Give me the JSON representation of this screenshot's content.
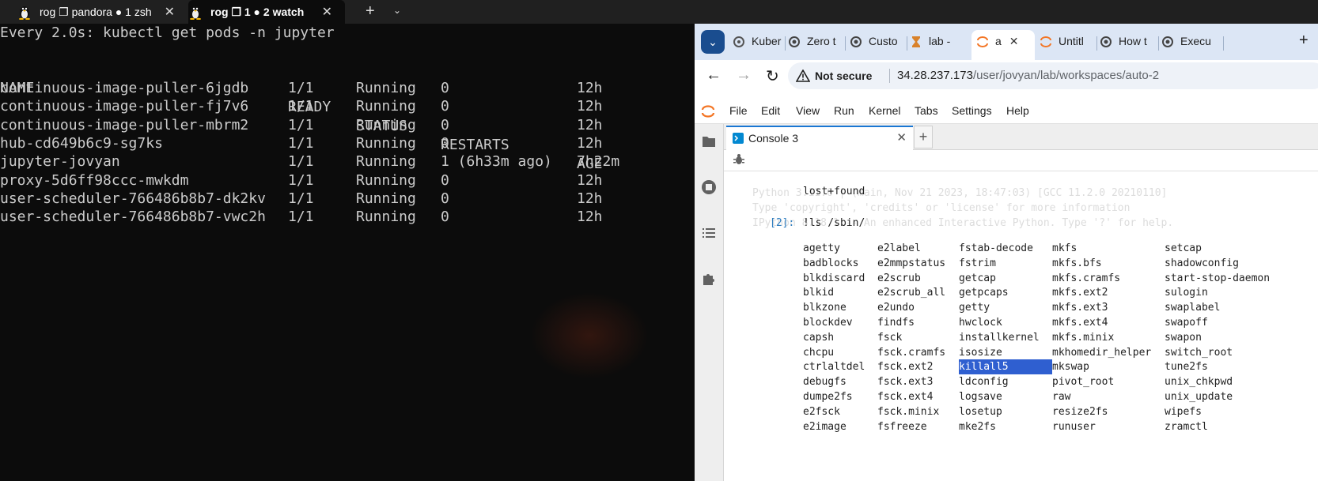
{
  "terminal": {
    "tabs": [
      {
        "label": "rog ❐ pandora ● 1 zsh"
      },
      {
        "label": "rog ❐ 1 ● 2 watch"
      }
    ],
    "header": "Every 2.0s: kubectl get pods -n jupyter",
    "columns": [
      "NAME",
      "READY",
      "STATUS",
      "RESTARTS",
      "AGE"
    ],
    "rows": [
      [
        "continuous-image-puller-6jgdb",
        "1/1",
        "Running",
        "0",
        "12h"
      ],
      [
        "continuous-image-puller-fj7v6",
        "1/1",
        "Running",
        "0",
        "12h"
      ],
      [
        "continuous-image-puller-mbrm2",
        "1/1",
        "Running",
        "0",
        "12h"
      ],
      [
        "hub-cd649b6c9-sg7ks",
        "1/1",
        "Running",
        "0",
        "12h"
      ],
      [
        "jupyter-jovyan",
        "1/1",
        "Running",
        "1 (6h33m ago)",
        "7h22m"
      ],
      [
        "proxy-5d6ff98ccc-mwkdm",
        "1/1",
        "Running",
        "0",
        "12h"
      ],
      [
        "user-scheduler-766486b8b7-dk2kv",
        "1/1",
        "Running",
        "0",
        "12h"
      ],
      [
        "user-scheduler-766486b8b7-vwc2h",
        "1/1",
        "Running",
        "0",
        "12h"
      ]
    ]
  },
  "browser": {
    "tabs": [
      {
        "label": "Kuber"
      },
      {
        "label": "Zero t"
      },
      {
        "label": "Custo"
      },
      {
        "label": "lab - "
      },
      {
        "label": "a"
      },
      {
        "label": "Untitl"
      },
      {
        "label": "How t"
      },
      {
        "label": "Execu"
      }
    ],
    "security": "Not secure",
    "url_host": "34.28.237.173",
    "url_path": "/user/jovyan/lab/workspaces/auto-2"
  },
  "jupyterlab": {
    "menus": [
      "File",
      "Edit",
      "View",
      "Run",
      "Kernel",
      "Tabs",
      "Settings",
      "Help"
    ],
    "console_tab": "Console 3",
    "ghost_lines": [
      "Python 3.11.6 | (main, Nov 21 2023, 18:47:03) [GCC 11.2.0 20210110]",
      "Type 'copyright', 'credits' or 'license' for more information",
      "IPython 8.18.1 -- An enhanced Interactive Python. Type '?' for help."
    ],
    "prev_output": "lost+found",
    "prompt": "[2]:",
    "command": "!ls /sbin/",
    "sbin_columns": [
      [
        "agetty",
        "badblocks",
        "blkdiscard",
        "blkid",
        "blkzone",
        "blockdev",
        "capsh",
        "chcpu",
        "ctrlaltdel",
        "debugfs",
        "dumpe2fs",
        "e2fsck",
        "e2image"
      ],
      [
        "e2label",
        "e2mmpstatus",
        "e2scrub",
        "e2scrub_all",
        "e2undo",
        "findfs",
        "fsck",
        "fsck.cramfs",
        "fsck.ext2",
        "fsck.ext3",
        "fsck.ext4",
        "fsck.minix",
        "fsfreeze"
      ],
      [
        "fstab-decode",
        "fstrim",
        "getcap",
        "getpcaps",
        "getty",
        "hwclock",
        "installkernel",
        "isosize",
        "killall5",
        "ldconfig",
        "logsave",
        "losetup",
        "mke2fs"
      ],
      [
        "mkfs",
        "mkfs.bfs",
        "mkfs.cramfs",
        "mkfs.ext2",
        "mkfs.ext3",
        "mkfs.ext4",
        "mkfs.minix",
        "mkhomedir_helper",
        "mkswap",
        "pivot_root",
        "raw",
        "resize2fs",
        "runuser"
      ],
      [
        "setcap",
        "shadowconfig",
        "start-stop-daemon",
        "sulogin",
        "swaplabel",
        "swapoff",
        "swapon",
        "switch_root",
        "tune2fs",
        "unix_chkpwd",
        "unix_update",
        "wipefs",
        "zramctl"
      ]
    ],
    "selected_item": "killall5",
    "colors": {
      "selection": "#2f5fd0",
      "prompt": "#307fc1",
      "accent": "#1976d2"
    }
  }
}
